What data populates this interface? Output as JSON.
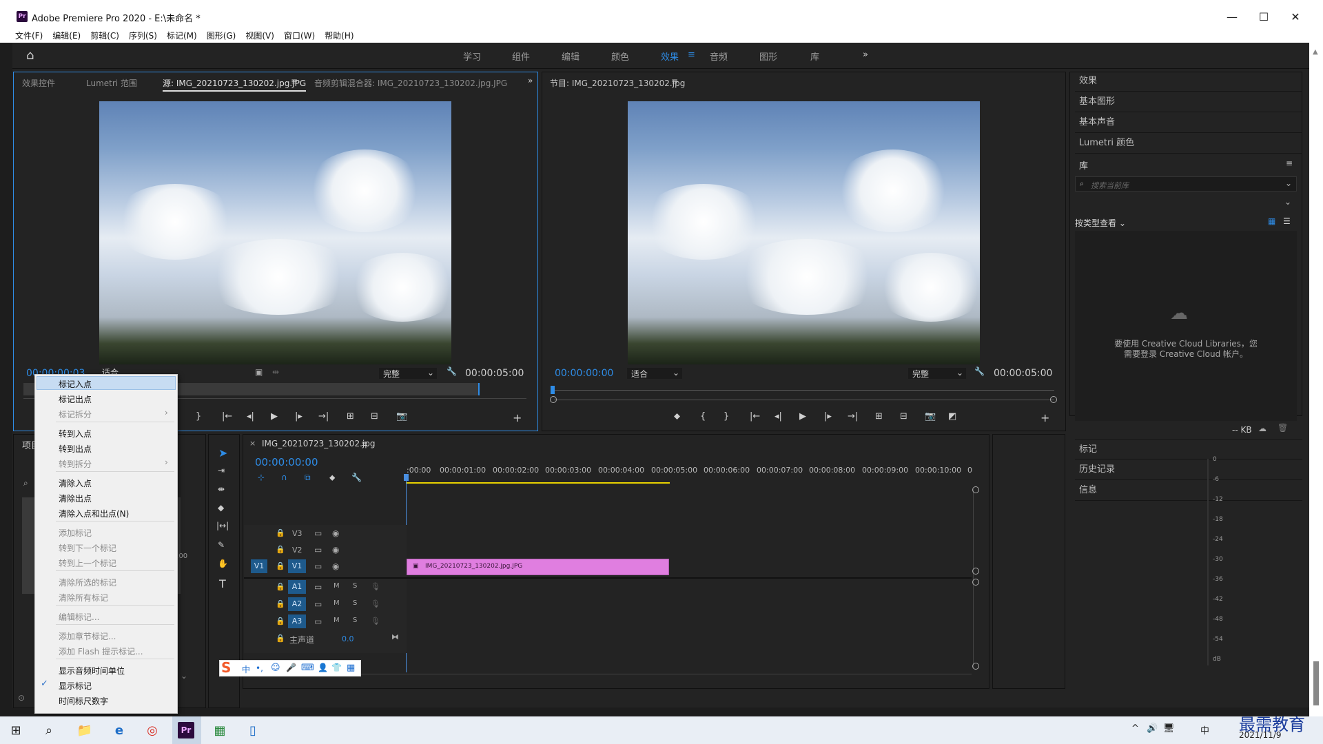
{
  "window": {
    "title": "Adobe Premiere Pro 2020 - E:\\未命名 *",
    "logo": "Pr",
    "controls": [
      "—",
      "☐",
      "✕"
    ]
  },
  "menu": [
    "文件(F)",
    "编辑(E)",
    "剪辑(C)",
    "序列(S)",
    "标记(M)",
    "图形(G)",
    "视图(V)",
    "窗口(W)",
    "帮助(H)"
  ],
  "workspaces": {
    "items": [
      "学习",
      "组件",
      "编辑",
      "颜色",
      "效果",
      "音频",
      "图形",
      "库"
    ],
    "active": "效果",
    "more": "»"
  },
  "source_panel": {
    "tabs": [
      "效果控件",
      "Lumetri 范围",
      "源: IMG_20210723_130202.jpg.JPG",
      "音频剪辑混合器: IMG_20210723_130202.jpg.JPG"
    ],
    "more": "»",
    "timecode": "00:00:00:03",
    "fit": "适合",
    "quality": "完整",
    "duration": "00:00:05:00"
  },
  "program_panel": {
    "title": "节目: IMG_20210723_130202.jpg",
    "timecode": "00:00:00:00",
    "fit": "适合",
    "quality": "完整",
    "duration": "00:00:05:00"
  },
  "right_panel": {
    "items": [
      "效果",
      "基本图形",
      "基本声音",
      "Lumetri 颜色"
    ],
    "library_title": "库",
    "search_placeholder": "搜索当前库",
    "view_by": "按类型查看",
    "cc_message_1": "要使用 Creative Cloud Libraries，您",
    "cc_message_2": "需要登录 Creative Cloud 帐户。",
    "kb": "-- KB",
    "lower_items": [
      "标记",
      "历史记录",
      "信息"
    ]
  },
  "project_panel": {
    "tab": "项目",
    "timecode_fragment": ":00"
  },
  "timeline": {
    "tab": "IMG_20210723_130202.jpg",
    "timecode": "00:00:00:00",
    "ruler": [
      ":00:00",
      "00:00:01:00",
      "00:00:02:00",
      "00:00:03:00",
      "00:00:04:00",
      "00:00:05:00",
      "00:00:06:00",
      "00:00:07:00",
      "00:00:08:00",
      "00:00:09:00",
      "00:00:10:00",
      "0"
    ],
    "video_tracks": [
      "V3",
      "V2",
      "V1"
    ],
    "audio_tracks": [
      "A1",
      "A2",
      "A3"
    ],
    "source_patch": "V1",
    "master": "主声道",
    "master_value": "0.0",
    "clip_name": "IMG_20210723_130202.jpg.JPG",
    "clip_color": "#e07ee0"
  },
  "audio_meter": {
    "labels": [
      "0",
      "-6",
      "-12",
      "-18",
      "-24",
      "-30",
      "-36",
      "-42",
      "-48",
      "-54",
      "dB"
    ]
  },
  "context_menu": {
    "items": [
      {
        "label": "标记入点",
        "enabled": true,
        "highlighted": true
      },
      {
        "label": "标记出点",
        "enabled": true
      },
      {
        "label": "标记拆分",
        "enabled": false,
        "submenu": true
      },
      {
        "label": "转到入点",
        "enabled": true
      },
      {
        "label": "转到出点",
        "enabled": true
      },
      {
        "label": "转到拆分",
        "enabled": false,
        "submenu": true
      },
      {
        "label": "清除入点",
        "enabled": true
      },
      {
        "label": "清除出点",
        "enabled": true
      },
      {
        "label": "清除入点和出点(N)",
        "enabled": true
      },
      {
        "label": "添加标记",
        "enabled": false
      },
      {
        "label": "转到下一个标记",
        "enabled": false
      },
      {
        "label": "转到上一个标记",
        "enabled": false
      },
      {
        "label": "清除所选的标记",
        "enabled": false
      },
      {
        "label": "清除所有标记",
        "enabled": false
      },
      {
        "label": "编辑标记...",
        "enabled": false
      },
      {
        "label": "添加章节标记...",
        "enabled": false
      },
      {
        "label": "添加 Flash 提示标记...",
        "enabled": false
      },
      {
        "label": "显示音频时间单位",
        "enabled": true
      },
      {
        "label": "显示标记",
        "enabled": true,
        "checked": true
      },
      {
        "label": "时间标尺数字",
        "enabled": true
      }
    ]
  },
  "ime_toolbar": {
    "logo": "S",
    "items": [
      "中",
      "•,",
      "☺",
      "🎤",
      "⌨",
      "👤",
      "👕",
      "▦"
    ]
  },
  "taskbar": {
    "date": "2021/11/9",
    "watermark": "最需教育",
    "tray": [
      "^",
      "🔊",
      "🖥",
      "中"
    ]
  },
  "colors": {
    "accent_blue": "#2e8ce6",
    "track_blue": "#1e5a8c",
    "playhead_blue": "#4a8fe0",
    "menu_highlight": "#c7dcf2"
  }
}
